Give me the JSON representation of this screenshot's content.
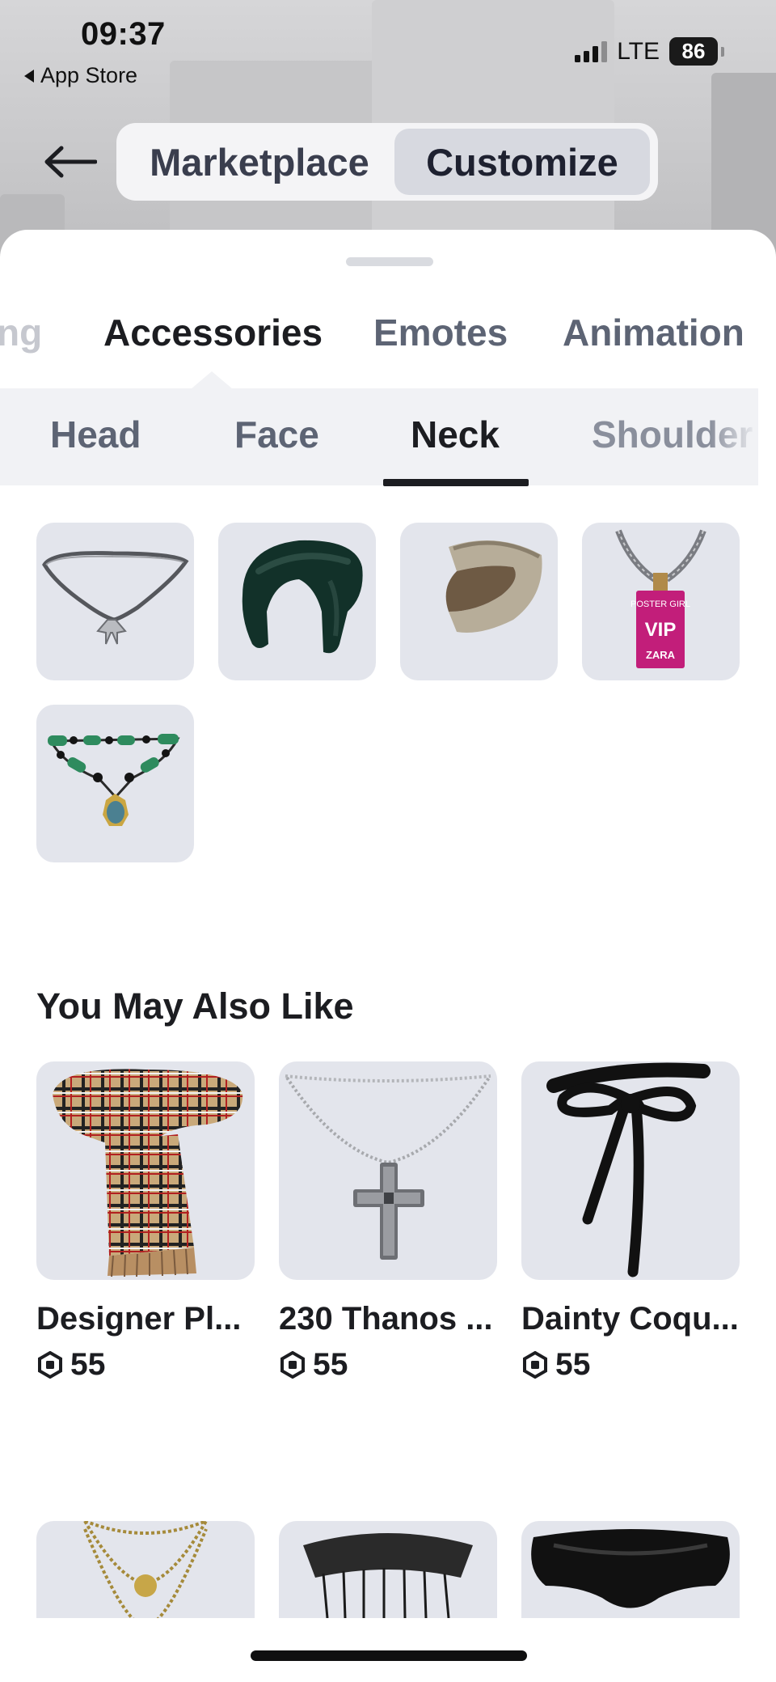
{
  "status_bar": {
    "time": "09:37",
    "back_label": "App Store",
    "network": "LTE",
    "battery": "86"
  },
  "header": {
    "tabs": [
      {
        "label": "Marketplace",
        "selected": false
      },
      {
        "label": "Customize",
        "selected": true
      }
    ]
  },
  "category_tabs": [
    {
      "label": "ng",
      "partial": true
    },
    {
      "label": "Accessories",
      "selected": true
    },
    {
      "label": "Emotes"
    },
    {
      "label": "Animation"
    }
  ],
  "sub_tabs": [
    {
      "label": "Head"
    },
    {
      "label": "Face"
    },
    {
      "label": "Neck",
      "selected": true
    },
    {
      "label": "Shoulder",
      "partial": true
    }
  ],
  "owned_items": [
    {
      "icon": "silver-chain-bow-necklace-icon"
    },
    {
      "icon": "dark-green-puffer-scarf-icon"
    },
    {
      "icon": "beige-knit-scarf-icon"
    },
    {
      "icon": "vip-lanyard-icon",
      "badge_lines": [
        "POSTER GIRL",
        "VIP",
        "ZARA"
      ]
    },
    {
      "icon": "green-bead-pendant-necklace-icon"
    }
  ],
  "recommendations": {
    "title": "You May Also Like",
    "items": [
      {
        "name": "Designer Pl...",
        "price": "55",
        "icon": "plaid-scarf-icon"
      },
      {
        "name": "230 Thanos ...",
        "price": "55",
        "icon": "cross-pendant-necklace-icon"
      },
      {
        "name": "Dainty Coqu...",
        "price": "55",
        "icon": "black-ribbon-bow-icon"
      }
    ],
    "more_items_icons": [
      "gold-layered-necklace-icon",
      "black-tassel-collar-icon",
      "black-shoulder-wrap-icon"
    ]
  },
  "colors": {
    "tile_bg": "#e3e5ec",
    "text_primary": "#1c1d21",
    "text_secondary": "#5d6474",
    "seg_selected_bg": "#d7d9e0"
  }
}
